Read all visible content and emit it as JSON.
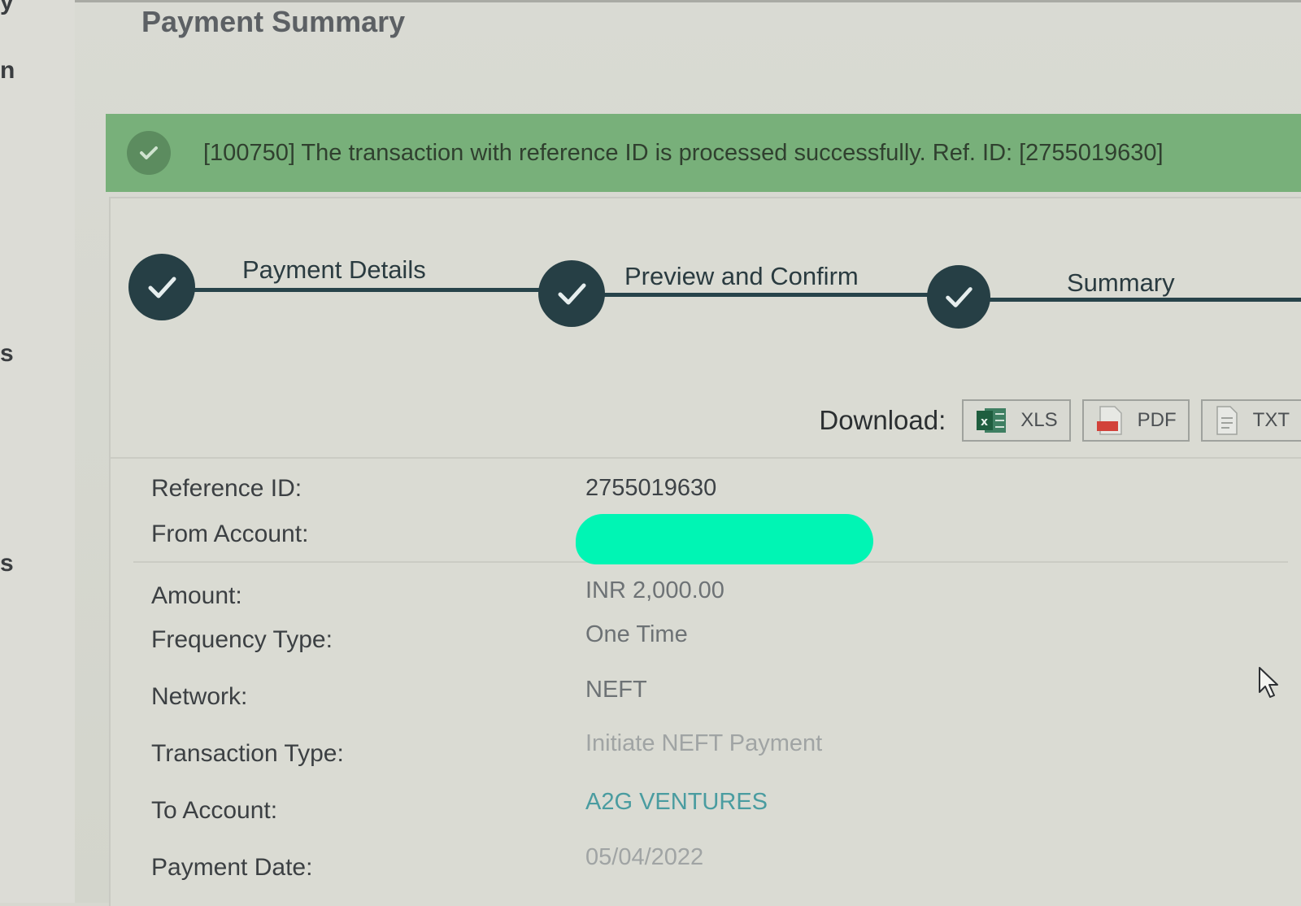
{
  "sidebar": {
    "fragments": [
      "y",
      "n",
      "s",
      "s"
    ]
  },
  "header": {
    "title": "Payment Summary"
  },
  "alert": {
    "message": "[100750] The transaction with reference ID is processed successfully. Ref. ID: [2755019630]",
    "icon": "check-circle-icon",
    "color": "#78b07a"
  },
  "stepper": {
    "steps": [
      {
        "label": "Payment Details",
        "status": "completed"
      },
      {
        "label": "Preview and Confirm",
        "status": "completed"
      },
      {
        "label": "Summary",
        "status": "completed"
      }
    ]
  },
  "download": {
    "label": "Download:",
    "buttons": [
      {
        "label": "XLS",
        "icon": "excel-icon"
      },
      {
        "label": "PDF",
        "icon": "pdf-icon"
      },
      {
        "label": "TXT",
        "icon": "txt-icon"
      }
    ]
  },
  "details": {
    "reference_id_label": "Reference ID:",
    "reference_id_value": "2755019630",
    "from_account_label": "From Account:",
    "amount_label": "Amount:",
    "amount_value": "INR 2,000.00",
    "frequency_label": "Frequency Type:",
    "frequency_value": "One Time",
    "network_label": "Network:",
    "network_value": "NEFT",
    "transaction_type_label": "Transaction Type:",
    "transaction_type_value": "Initiate NEFT Payment",
    "to_account_label": "To Account:",
    "to_account_value": "A2G VENTURES",
    "payment_date_label": "Payment Date:",
    "payment_date_value": "05/04/2022"
  }
}
